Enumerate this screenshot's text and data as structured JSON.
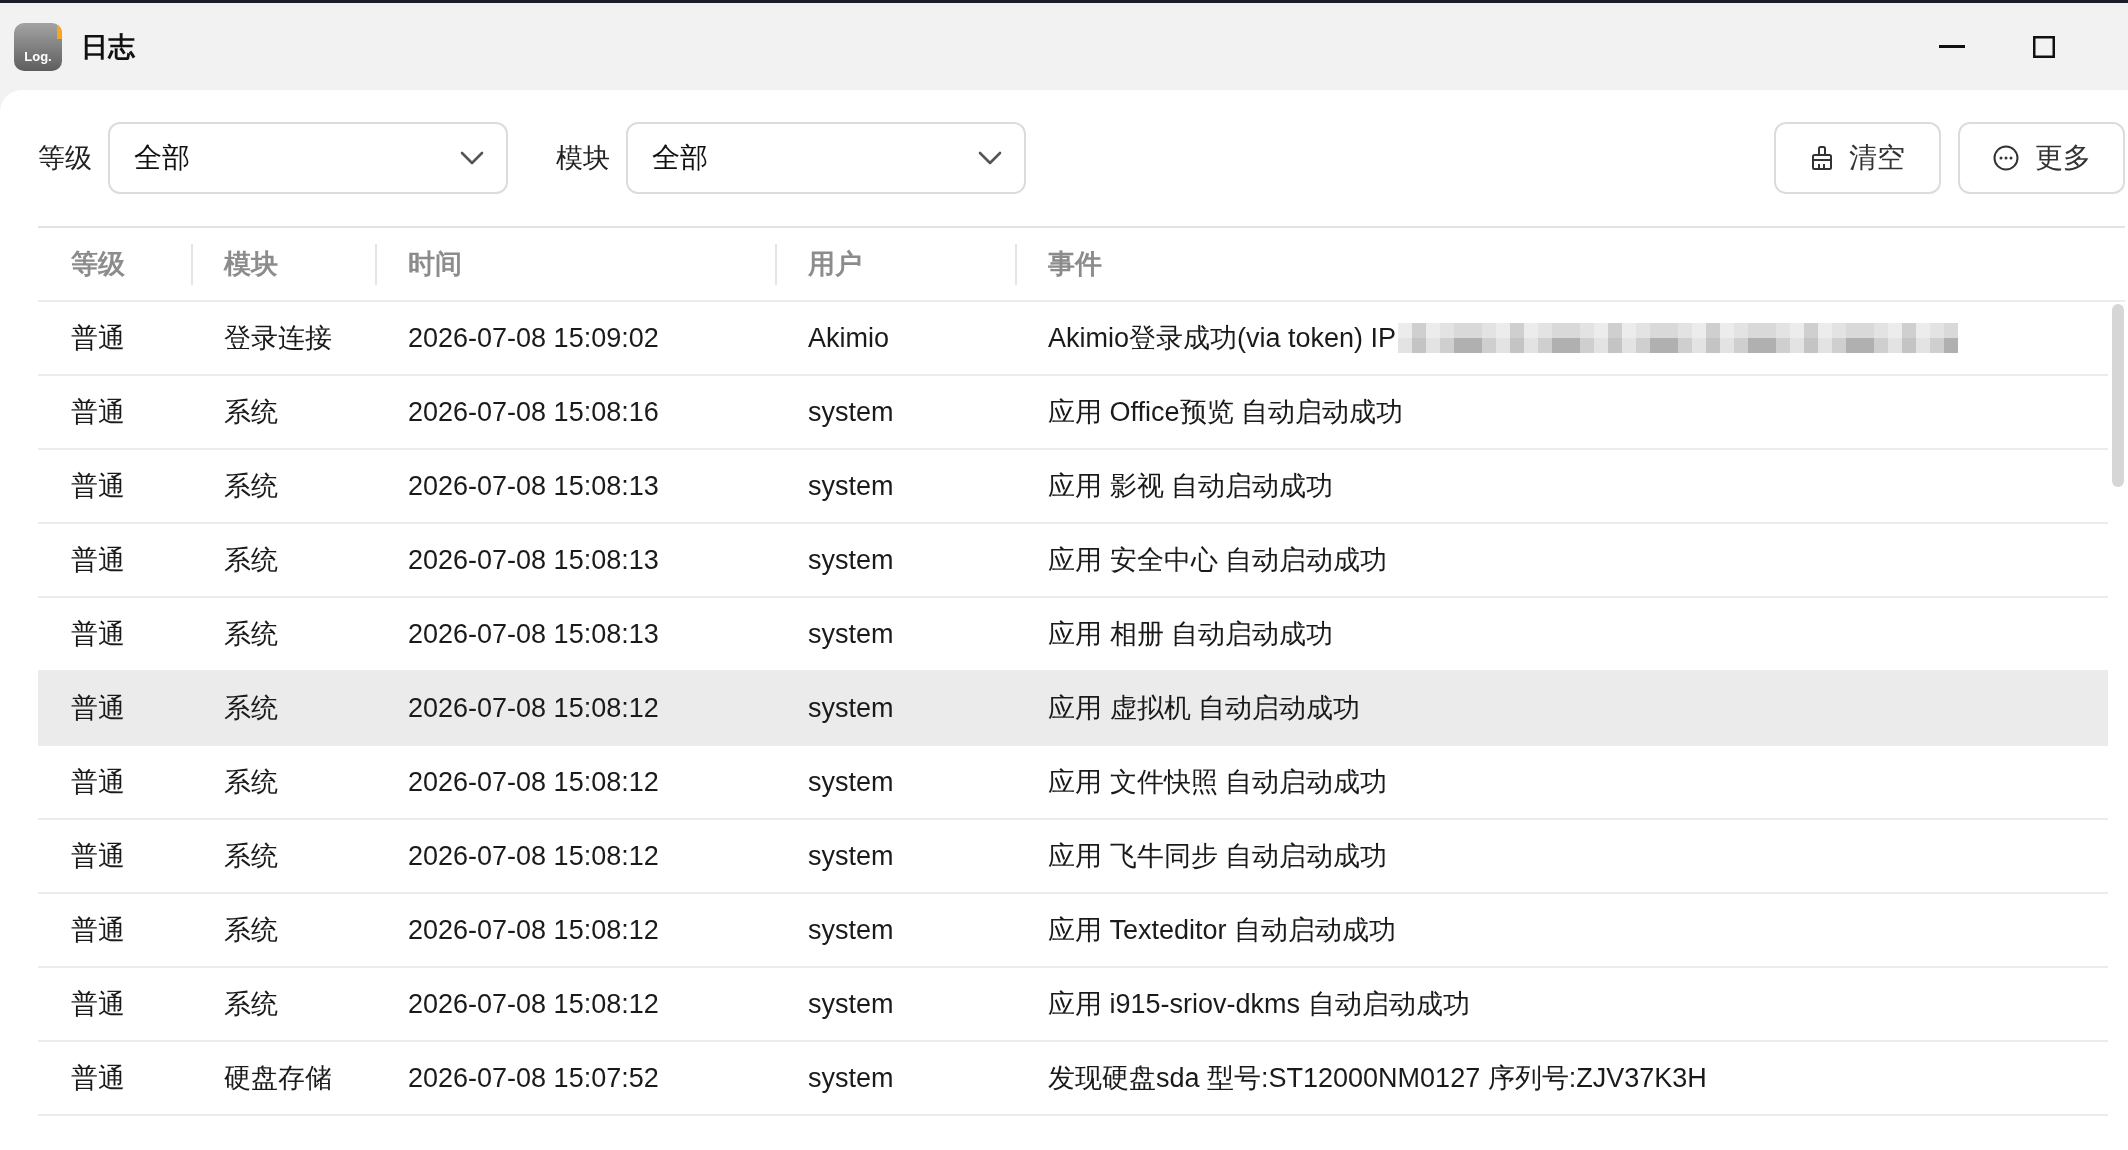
{
  "window": {
    "title": "日志",
    "app_icon_text": "Log."
  },
  "filters": [
    {
      "label": "等级",
      "value": "全部"
    },
    {
      "label": "模块",
      "value": "全部"
    }
  ],
  "actions": [
    {
      "label": "清空",
      "kind": "clear"
    },
    {
      "label": "更多",
      "kind": "more"
    }
  ],
  "table": {
    "columns": [
      "等级",
      "模块",
      "时间",
      "用户",
      "事件"
    ],
    "rows": [
      {
        "severity": "普通",
        "module": "登录连接",
        "time": "2026-07-08 15:09:02",
        "user": "Akimio",
        "event": "Akimio登录成功(via token) IP",
        "redacted": true,
        "selected": false
      },
      {
        "severity": "普通",
        "module": "系统",
        "time": "2026-07-08 15:08:16",
        "user": "system",
        "event": "应用 Office预览 自动启动成功",
        "redacted": false,
        "selected": false
      },
      {
        "severity": "普通",
        "module": "系统",
        "time": "2026-07-08 15:08:13",
        "user": "system",
        "event": "应用 影视 自动启动成功",
        "redacted": false,
        "selected": false
      },
      {
        "severity": "普通",
        "module": "系统",
        "time": "2026-07-08 15:08:13",
        "user": "system",
        "event": "应用 安全中心 自动启动成功",
        "redacted": false,
        "selected": false
      },
      {
        "severity": "普通",
        "module": "系统",
        "time": "2026-07-08 15:08:13",
        "user": "system",
        "event": "应用 相册 自动启动成功",
        "redacted": false,
        "selected": false
      },
      {
        "severity": "普通",
        "module": "系统",
        "time": "2026-07-08 15:08:12",
        "user": "system",
        "event": "应用 虚拟机 自动启动成功",
        "redacted": false,
        "selected": true
      },
      {
        "severity": "普通",
        "module": "系统",
        "time": "2026-07-08 15:08:12",
        "user": "system",
        "event": "应用 文件快照 自动启动成功",
        "redacted": false,
        "selected": false
      },
      {
        "severity": "普通",
        "module": "系统",
        "time": "2026-07-08 15:08:12",
        "user": "system",
        "event": "应用 飞牛同步 自动启动成功",
        "redacted": false,
        "selected": false
      },
      {
        "severity": "普通",
        "module": "系统",
        "time": "2026-07-08 15:08:12",
        "user": "system",
        "event": "应用 Texteditor 自动启动成功",
        "redacted": false,
        "selected": false
      },
      {
        "severity": "普通",
        "module": "系统",
        "time": "2026-07-08 15:08:12",
        "user": "system",
        "event": "应用 i915-sriov-dkms 自动启动成功",
        "redacted": false,
        "selected": false
      },
      {
        "severity": "普通",
        "module": "硬盘存储",
        "time": "2026-07-08 15:07:52",
        "user": "system",
        "event": "发现硬盘sda 型号:ST12000NM0127 序列号:ZJV37K3H",
        "redacted": false,
        "selected": false
      }
    ]
  }
}
